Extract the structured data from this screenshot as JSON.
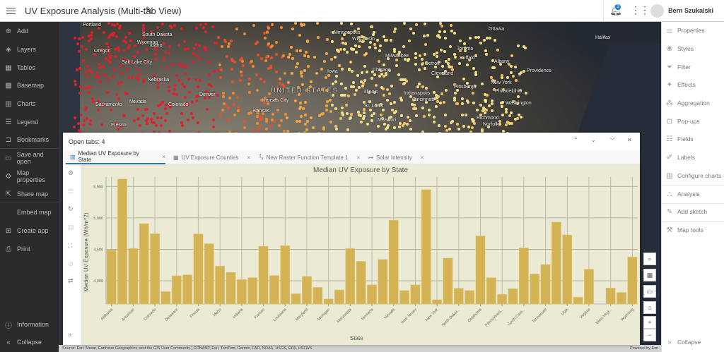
{
  "header": {
    "title": "UV Exposure Analysis (Multi-tab View)",
    "notification_count": "3",
    "user_name": "Bern Szukalski"
  },
  "left_sidebar": {
    "items": [
      {
        "label": "Add",
        "icon": "plus-circle-icon"
      },
      {
        "label": "Layers",
        "icon": "layers-icon"
      },
      {
        "label": "Tables",
        "icon": "table-icon"
      },
      {
        "label": "Basemap",
        "icon": "basemap-icon"
      },
      {
        "label": "Charts",
        "icon": "chart-icon"
      },
      {
        "label": "Legend",
        "icon": "legend-icon"
      },
      {
        "label": "Bookmarks",
        "icon": "bookmark-icon"
      },
      {
        "label": "Save and open",
        "icon": "save-icon"
      },
      {
        "label": "Map properties",
        "icon": "gear-icon"
      },
      {
        "label": "Share map",
        "icon": "share-icon"
      },
      {
        "label": "Embed map",
        "icon": "code-icon"
      },
      {
        "label": "Create app",
        "icon": "apps-icon"
      },
      {
        "label": "Print",
        "icon": "print-icon"
      }
    ],
    "information": "Information",
    "collapse": "Collapse"
  },
  "right_sidebar": {
    "items": [
      {
        "label": "Properties"
      },
      {
        "label": "Styles"
      },
      {
        "label": "Filter"
      },
      {
        "label": "Effects"
      },
      {
        "label": "Aggregation"
      },
      {
        "label": "Pop-ups"
      },
      {
        "label": "Fields"
      },
      {
        "label": "Labels"
      },
      {
        "label": "Configure charts"
      },
      {
        "label": "Analysis"
      },
      {
        "label": "Add sketch"
      },
      {
        "label": "Map tools"
      }
    ],
    "collapse": "Collapse"
  },
  "map": {
    "labels": [
      "Portland",
      "Oregon",
      "Idaho",
      "Wyoming",
      "Salt Lake City",
      "Nevada",
      "Sacramento",
      "Fresno",
      "South Dakota",
      "Nebraska",
      "Denver",
      "Colorado",
      "UNITED STATES",
      "Kansas",
      "Kansas City",
      "Minneapolis",
      "Wisconsin",
      "Iowa",
      "Milwaukee",
      "Chicago",
      "Illinois",
      "St. Louis",
      "Missouri",
      "Indianapolis",
      "Cincinnati",
      "Detroit",
      "Cleveland",
      "Pittsburgh",
      "Toronto",
      "Buffalo",
      "Ottawa",
      "Albany",
      "Providence",
      "New York",
      "Philadelphia",
      "Washington",
      "Richmond",
      "Norfolk",
      "Halifax"
    ],
    "attribution": "Source: Esri, Maxar, Earthstar Geographics, and the GIS User Community | CONANP, Esri, TomTom, Garmin, FAO, NOAA, USGS, EPA, USFWS",
    "powered_by": "Powered by Esri"
  },
  "panel": {
    "open_tabs": "Open tabs: 4",
    "tabs": [
      {
        "label": "Median UV Exposure by State",
        "icon": "bar-chart-icon",
        "active": true
      },
      {
        "label": "UV Exposure Counties",
        "icon": "table-icon",
        "active": false
      },
      {
        "label": "New Raster Function Template 1",
        "icon": "function-icon",
        "active": false
      },
      {
        "label": "Solar Intensity",
        "icon": "model-icon",
        "active": false
      }
    ]
  },
  "chart_data": {
    "type": "bar",
    "title": "Median UV Exposure by State",
    "xlabel": "State",
    "ylabel": "Median UV Exposure (Wh/m^2)",
    "ylim": [
      3630,
      5650
    ],
    "yticks": [
      4000,
      4500,
      5000,
      5500
    ],
    "ytick_labels": [
      "4,000",
      "4,500",
      "5,000",
      "5,500"
    ],
    "grid": true,
    "bar_color": "#d4b355",
    "background": "#ebead5",
    "categories": [
      "Alabama",
      "Arizona",
      "Arkansas",
      "California",
      "Colorado",
      "Connecticut",
      "Delaware",
      "District of Columbia",
      "Florida",
      "Georgia",
      "Idaho",
      "Illinois",
      "Indiana",
      "Iowa",
      "Kansas",
      "Kentucky",
      "Louisiana",
      "Maine",
      "Maryland",
      "Massachusetts",
      "Michigan",
      "Minnesota",
      "Mississippi",
      "Missouri",
      "Montana",
      "Nebraska",
      "Nevada",
      "New Hampshire",
      "New Jersey",
      "New Mexico",
      "New York",
      "North Carolina",
      "North Dakot...",
      "Ohio",
      "Oklahoma",
      "Oregon",
      "Pennsylvani...",
      "Rhode Island",
      "South Caro...",
      "South Dakota",
      "Tennessee",
      "Texas",
      "Utah",
      "Vermont",
      "Virginia",
      "Washington",
      "West Virgi...",
      "Wisconsin",
      "Wyoming"
    ],
    "values": [
      4490,
      5620,
      4515,
      4910,
      4750,
      3830,
      4080,
      4095,
      4745,
      4590,
      4235,
      4135,
      4020,
      4050,
      4550,
      4085,
      4560,
      3795,
      4070,
      3895,
      3710,
      3855,
      4515,
      4310,
      3935,
      4340,
      4965,
      3845,
      3935,
      5450,
      3700,
      4360,
      3880,
      3845,
      4715,
      4050,
      3785,
      3875,
      4525,
      4110,
      4260,
      4935,
      4730,
      3740,
      4185,
      null,
      3885,
      3815,
      4380
    ]
  },
  "map_controls": [
    "search-icon",
    "basemap-gallery-icon",
    "fullscreen-icon",
    "home-icon",
    "zoom-in-icon",
    "zoom-out-icon"
  ],
  "zoom_in": "+",
  "zoom_out": "−"
}
